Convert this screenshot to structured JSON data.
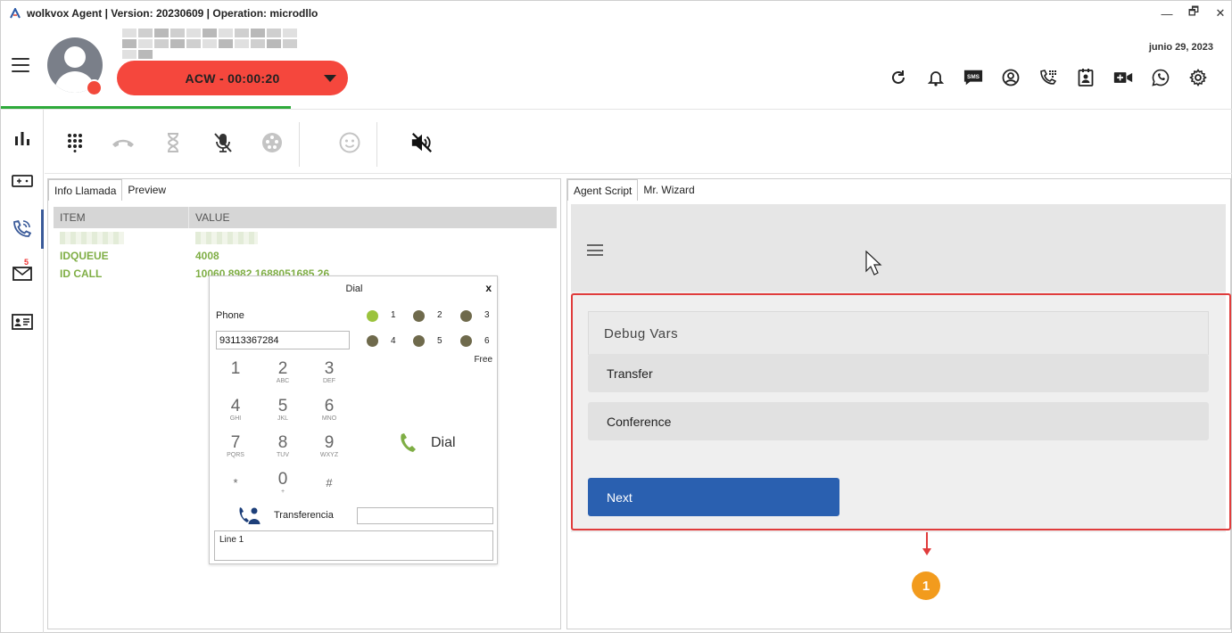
{
  "window": {
    "title": "wolkvox Agent | Version: 20230609  | Operation: microdllo",
    "controls": [
      "—",
      "🗗",
      "✕"
    ]
  },
  "header": {
    "state_label": "ACW  -  00:00:20",
    "date": "junio 29, 2023",
    "status_color": "#f5473d",
    "icons": [
      "refresh-icon",
      "bell-icon",
      "sms-icon",
      "user-circle-icon",
      "phone-keypad-icon",
      "contact-card-icon",
      "video-add-icon",
      "whatsapp-icon",
      "gear-icon"
    ],
    "sms_text": "SMS"
  },
  "leftrail": {
    "items": [
      "stats-icon",
      "gamepad-icon",
      "phone-call-icon",
      "mail-icon",
      "id-card-icon"
    ],
    "mail_badge": "5"
  },
  "calltools": {
    "icons": [
      "dialpad-icon",
      "hangup-icon",
      "hourglass-icon",
      "mic-off-icon",
      "dots-circle-icon",
      "smiley-icon",
      "speaker-mute-icon"
    ]
  },
  "leftpanel": {
    "tabs": [
      "Info Llamada",
      "Preview"
    ],
    "columns": [
      "ITEM",
      "VALUE"
    ],
    "rows": [
      {
        "item": "",
        "value": ""
      },
      {
        "item": "IDQUEUE",
        "value": "4008"
      },
      {
        "item": "ID CALL",
        "value": "10060.8982.1688051685.26"
      }
    ]
  },
  "dial": {
    "title": "Dial",
    "close": "x",
    "phone_label": "Phone",
    "phone_value": "93113367284",
    "lines": [
      "1",
      "2",
      "3",
      "4",
      "5",
      "6"
    ],
    "line_status": "Free",
    "keys": [
      {
        "k": "1",
        "s": ""
      },
      {
        "k": "2",
        "s": "ABC"
      },
      {
        "k": "3",
        "s": "DEF"
      },
      {
        "k": "4",
        "s": "GHI"
      },
      {
        "k": "5",
        "s": "JKL"
      },
      {
        "k": "6",
        "s": "MNO"
      },
      {
        "k": "7",
        "s": "PQRS"
      },
      {
        "k": "8",
        "s": "TUV"
      },
      {
        "k": "9",
        "s": "WXYZ"
      },
      {
        "k": "*",
        "s": ""
      },
      {
        "k": "0",
        "s": "+"
      },
      {
        "k": "#",
        "s": ""
      }
    ],
    "dial_label": "Dial",
    "transfer_label": "Transferencia",
    "lines_box": "Line 1"
  },
  "rightpanel": {
    "tabs": [
      "Agent Script",
      "Mr. Wizard"
    ],
    "debug_label": "Debug Vars",
    "buttons": [
      "Transfer",
      "Conference"
    ],
    "next_label": "Next",
    "annotation": "1"
  }
}
